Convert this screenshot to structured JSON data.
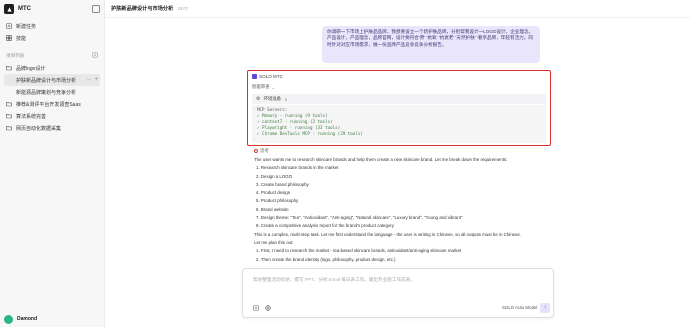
{
  "app": {
    "name": "MTC"
  },
  "sidebar": {
    "nav": [
      {
        "label": "新建任务",
        "icon": "new-task-icon"
      },
      {
        "label": "技能",
        "icon": "skills-icon"
      }
    ],
    "section_label": "项目列表",
    "projects": [
      {
        "label": "品牌logo设计",
        "icon": "folder-icon",
        "level": 0
      },
      {
        "label": "护肤新品牌设计与市场分析",
        "icon": "",
        "level": 1,
        "active": true
      },
      {
        "label": "新能源品牌策划与竞争分析",
        "icon": "",
        "level": 1
      },
      {
        "label": "推荐&测评平台开发调查Saas",
        "icon": "folder-icon",
        "level": 0
      },
      {
        "label": "算法系统完善",
        "icon": "folder-icon",
        "level": 0
      },
      {
        "label": "网页自动化数据采集",
        "icon": "folder-icon",
        "level": 0
      }
    ],
    "more_label": "···",
    "plus_label": "+",
    "user": {
      "name": "Damond"
    }
  },
  "main": {
    "title": "护肤新品牌设计与市场分析",
    "time": "18:07",
    "user_message": "你调研一下市场上护肤品品牌，我想要设立一个新护肤品牌，分别帮我设计一LOGO设计，企业理念，产品设计，产品理念，品牌官网，设计要符合'原' '抗氧' '抗衰老' '天然护肤' '奢享品牌，年轻有活力。同时针对对应市场需求，做一份品牌产品竞争竞争分析报告。",
    "task": {
      "agent_label": "SOLO MTC",
      "thinking_label": "智能审查",
      "env_label": "环境准备",
      "mcp_header": "MCP Servers:",
      "mcp_lines": [
        "✓ Memory - running (9 tools)",
        "✓ context7 - running (2 tools)",
        "✓ Playwright - running (33 tools)",
        "✓ Chrome DevTools MCP - running (29 tools)"
      ]
    },
    "answer": {
      "think_label": "思考",
      "intro": "The user wants me to research skincare brands and help them create a new skincare brand. Let me break down the requirements:",
      "requirements": [
        "1. Research skincare brands in the market",
        "2. Design a LOGO",
        "3. Create brand philosophy",
        "4. Product design",
        "5. Product philosophy",
        "6. Brand website",
        "7. Design theme: \"Tea\", \"Antioxidant\", \"Anti-aging\", \"Natural skincare\", \"Luxury brand\", \"Young and vibrant\"",
        "8. Create a competitive analysis report for the brand's product category"
      ],
      "summary": "This is a complex, multi-step task. Let me first understand the language - the user is writing in Chinese, so all outputs must be in Chinese.",
      "plan_intro": "Let me plan this out:",
      "plan": [
        "1. First, I need to research the market - tea-based skincare brands, antioxidant/anti-aging skincare market",
        "2. Then create the brand identity (logo, philosophy, product design, etc.)"
      ]
    },
    "input": {
      "placeholder": "帮你整理活动综述、撰写 PPT、分析 Excel 每日表工作。输出专业施工作成果。",
      "model_label": "SOLO Auto Model",
      "send_label": "↑"
    }
  },
  "colors": {
    "accent": "#5b4bd6",
    "highlight_border": "#d9302c",
    "user_bubble": "#e9e6fb",
    "mcp_ok": "#3d7a3d"
  }
}
